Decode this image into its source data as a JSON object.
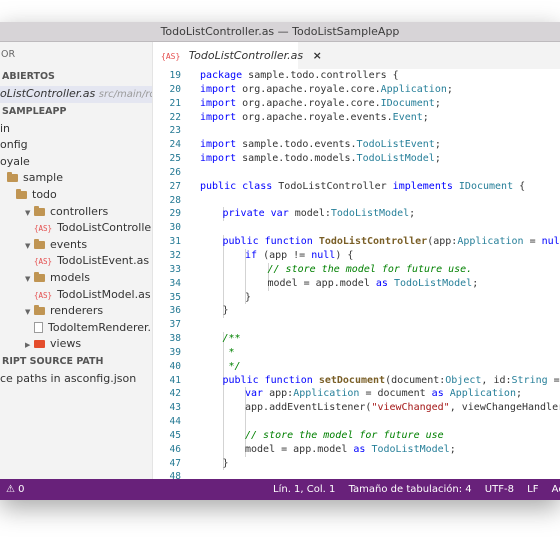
{
  "window": {
    "title": "TodoListController.as — TodoListSampleApp"
  },
  "sidebar": {
    "explorer_label": "OR",
    "open_editors_label": "ABIERTOS",
    "open_file": {
      "name": "oListController.as",
      "path": "src/main/royal..."
    },
    "project_label": "SAMPLEAPP",
    "tree": [
      {
        "label": "in",
        "indent": 0,
        "icon": "none"
      },
      {
        "label": "onfig",
        "indent": 0,
        "icon": "none"
      },
      {
        "label": "oyale",
        "indent": 0,
        "icon": "none"
      },
      {
        "label": "sample",
        "indent": 1,
        "icon": "folder"
      },
      {
        "label": "todo",
        "indent": 2,
        "icon": "folder"
      },
      {
        "label": "controllers",
        "indent": 3,
        "icon": "folder",
        "chevron": "▼"
      },
      {
        "label": "TodoListController.as",
        "indent": 4,
        "icon": "as"
      },
      {
        "label": "events",
        "indent": 3,
        "icon": "folder",
        "chevron": "▼"
      },
      {
        "label": "TodoListEvent.as",
        "indent": 4,
        "icon": "as"
      },
      {
        "label": "models",
        "indent": 3,
        "icon": "folder",
        "chevron": "▼"
      },
      {
        "label": "TodoListModel.as",
        "indent": 4,
        "icon": "as"
      },
      {
        "label": "renderers",
        "indent": 3,
        "icon": "folder",
        "chevron": "▼"
      },
      {
        "label": "TodoItemRenderer.mxml",
        "indent": 4,
        "icon": "mxml"
      },
      {
        "label": "views",
        "indent": 3,
        "icon": "views",
        "chevron": "▶"
      }
    ],
    "script_source_label": "RIPT SOURCE PATH",
    "source_paths_text": "ce paths in asconfig.json"
  },
  "tab": {
    "label": "TodoListController.as",
    "close_symbol": "×",
    "type_badge": "{AS}"
  },
  "editor": {
    "lines": [
      {
        "n": "19",
        "g": 0,
        "t": [
          [
            "k",
            "package "
          ],
          [
            "",
            "sample.todo.controllers {"
          ]
        ]
      },
      {
        "n": "20",
        "g": 1,
        "t": [
          [
            "k",
            "import "
          ],
          [
            "",
            "org.apache.royale.core."
          ],
          [
            "t",
            "Application"
          ],
          [
            "",
            ";"
          ]
        ]
      },
      {
        "n": "21",
        "g": 1,
        "t": [
          [
            "k",
            "import "
          ],
          [
            "",
            "org.apache.royale.core."
          ],
          [
            "t",
            "IDocument"
          ],
          [
            "",
            ";"
          ]
        ]
      },
      {
        "n": "22",
        "g": 1,
        "t": [
          [
            "k",
            "import "
          ],
          [
            "",
            "org.apache.royale.events."
          ],
          [
            "t",
            "Event"
          ],
          [
            "",
            ";"
          ]
        ]
      },
      {
        "n": "23",
        "g": 0,
        "t": []
      },
      {
        "n": "24",
        "g": 1,
        "t": [
          [
            "k",
            "import "
          ],
          [
            "",
            "sample.todo.events."
          ],
          [
            "t",
            "TodoListEvent"
          ],
          [
            "",
            ";"
          ]
        ]
      },
      {
        "n": "25",
        "g": 1,
        "t": [
          [
            "k",
            "import "
          ],
          [
            "",
            "sample.todo.models."
          ],
          [
            "t",
            "TodoListModel"
          ],
          [
            "",
            ";"
          ]
        ]
      },
      {
        "n": "26",
        "g": 0,
        "t": []
      },
      {
        "n": "27",
        "g": 1,
        "t": [
          [
            "k",
            "public class "
          ],
          [
            "",
            "TodoListController "
          ],
          [
            "k",
            "implements "
          ],
          [
            "t",
            "IDocument"
          ],
          [
            "",
            " {"
          ]
        ]
      },
      {
        "n": "28",
        "g": 1,
        "t": []
      },
      {
        "n": "29",
        "g": 2,
        "t": [
          [
            "k",
            "private var "
          ],
          [
            "",
            "model:"
          ],
          [
            "t",
            "TodoListModel"
          ],
          [
            "",
            ";"
          ]
        ]
      },
      {
        "n": "30",
        "g": 1,
        "t": []
      },
      {
        "n": "31",
        "g": 2,
        "t": [
          [
            "k",
            "public function "
          ],
          [
            "f",
            "TodoListController"
          ],
          [
            "",
            "(app:"
          ],
          [
            "t",
            "Application"
          ],
          [
            "",
            " = "
          ],
          [
            "k",
            "null"
          ],
          [
            "",
            ") {"
          ]
        ]
      },
      {
        "n": "32",
        "g": 3,
        "t": [
          [
            "k",
            "if "
          ],
          [
            "",
            "(app != "
          ],
          [
            "k",
            "null"
          ],
          [
            "",
            ") {"
          ]
        ]
      },
      {
        "n": "33",
        "g": 4,
        "t": [
          [
            "c",
            "// store the model for future use."
          ]
        ]
      },
      {
        "n": "34",
        "g": 4,
        "t": [
          [
            "",
            "model = app.model "
          ],
          [
            "k",
            "as "
          ],
          [
            "t",
            "TodoListModel"
          ],
          [
            "",
            ";"
          ]
        ]
      },
      {
        "n": "35",
        "g": 3,
        "t": [
          [
            "",
            "}"
          ]
        ]
      },
      {
        "n": "36",
        "g": 2,
        "t": [
          [
            "",
            "}"
          ]
        ]
      },
      {
        "n": "37",
        "g": 1,
        "t": []
      },
      {
        "n": "38",
        "g": 2,
        "t": [
          [
            "c",
            "/**"
          ]
        ]
      },
      {
        "n": "39",
        "g": 2,
        "t": [
          [
            "c",
            " *"
          ]
        ]
      },
      {
        "n": "40",
        "g": 2,
        "t": [
          [
            "c",
            " */"
          ]
        ]
      },
      {
        "n": "41",
        "g": 2,
        "t": [
          [
            "k",
            "public function "
          ],
          [
            "f",
            "setDocument"
          ],
          [
            "",
            "(document:"
          ],
          [
            "t",
            "Object"
          ],
          [
            "",
            ", id:"
          ],
          [
            "t",
            "String"
          ],
          [
            "",
            " = n"
          ]
        ]
      },
      {
        "n": "42",
        "g": 3,
        "t": [
          [
            "k",
            "var "
          ],
          [
            "",
            "app:"
          ],
          [
            "t",
            "Application"
          ],
          [
            "",
            " = document "
          ],
          [
            "k",
            "as "
          ],
          [
            "t",
            "Application"
          ],
          [
            "",
            ";"
          ]
        ]
      },
      {
        "n": "43",
        "g": 3,
        "t": [
          [
            "",
            "app.addEventListener("
          ],
          [
            "s",
            "\"viewChanged\""
          ],
          [
            "",
            ", viewChangeHandler);"
          ]
        ]
      },
      {
        "n": "44",
        "g": 3,
        "t": []
      },
      {
        "n": "45",
        "g": 3,
        "t": [
          [
            "c",
            "// store the model for future use"
          ]
        ]
      },
      {
        "n": "46",
        "g": 3,
        "t": [
          [
            "",
            "model = app.model "
          ],
          [
            "k",
            "as "
          ],
          [
            "t",
            "TodoListModel"
          ],
          [
            "",
            ";"
          ]
        ]
      },
      {
        "n": "47",
        "g": 2,
        "t": [
          [
            "",
            "}"
          ]
        ]
      },
      {
        "n": "48",
        "g": 1,
        "t": []
      }
    ]
  },
  "statusbar": {
    "problems": "⚠ 0",
    "position": "Lín. 1, Col. 1",
    "tab_size": "Tamaño de tabulación: 4",
    "encoding": "UTF-8",
    "line_ending": "LF",
    "language": "ActionScript"
  }
}
